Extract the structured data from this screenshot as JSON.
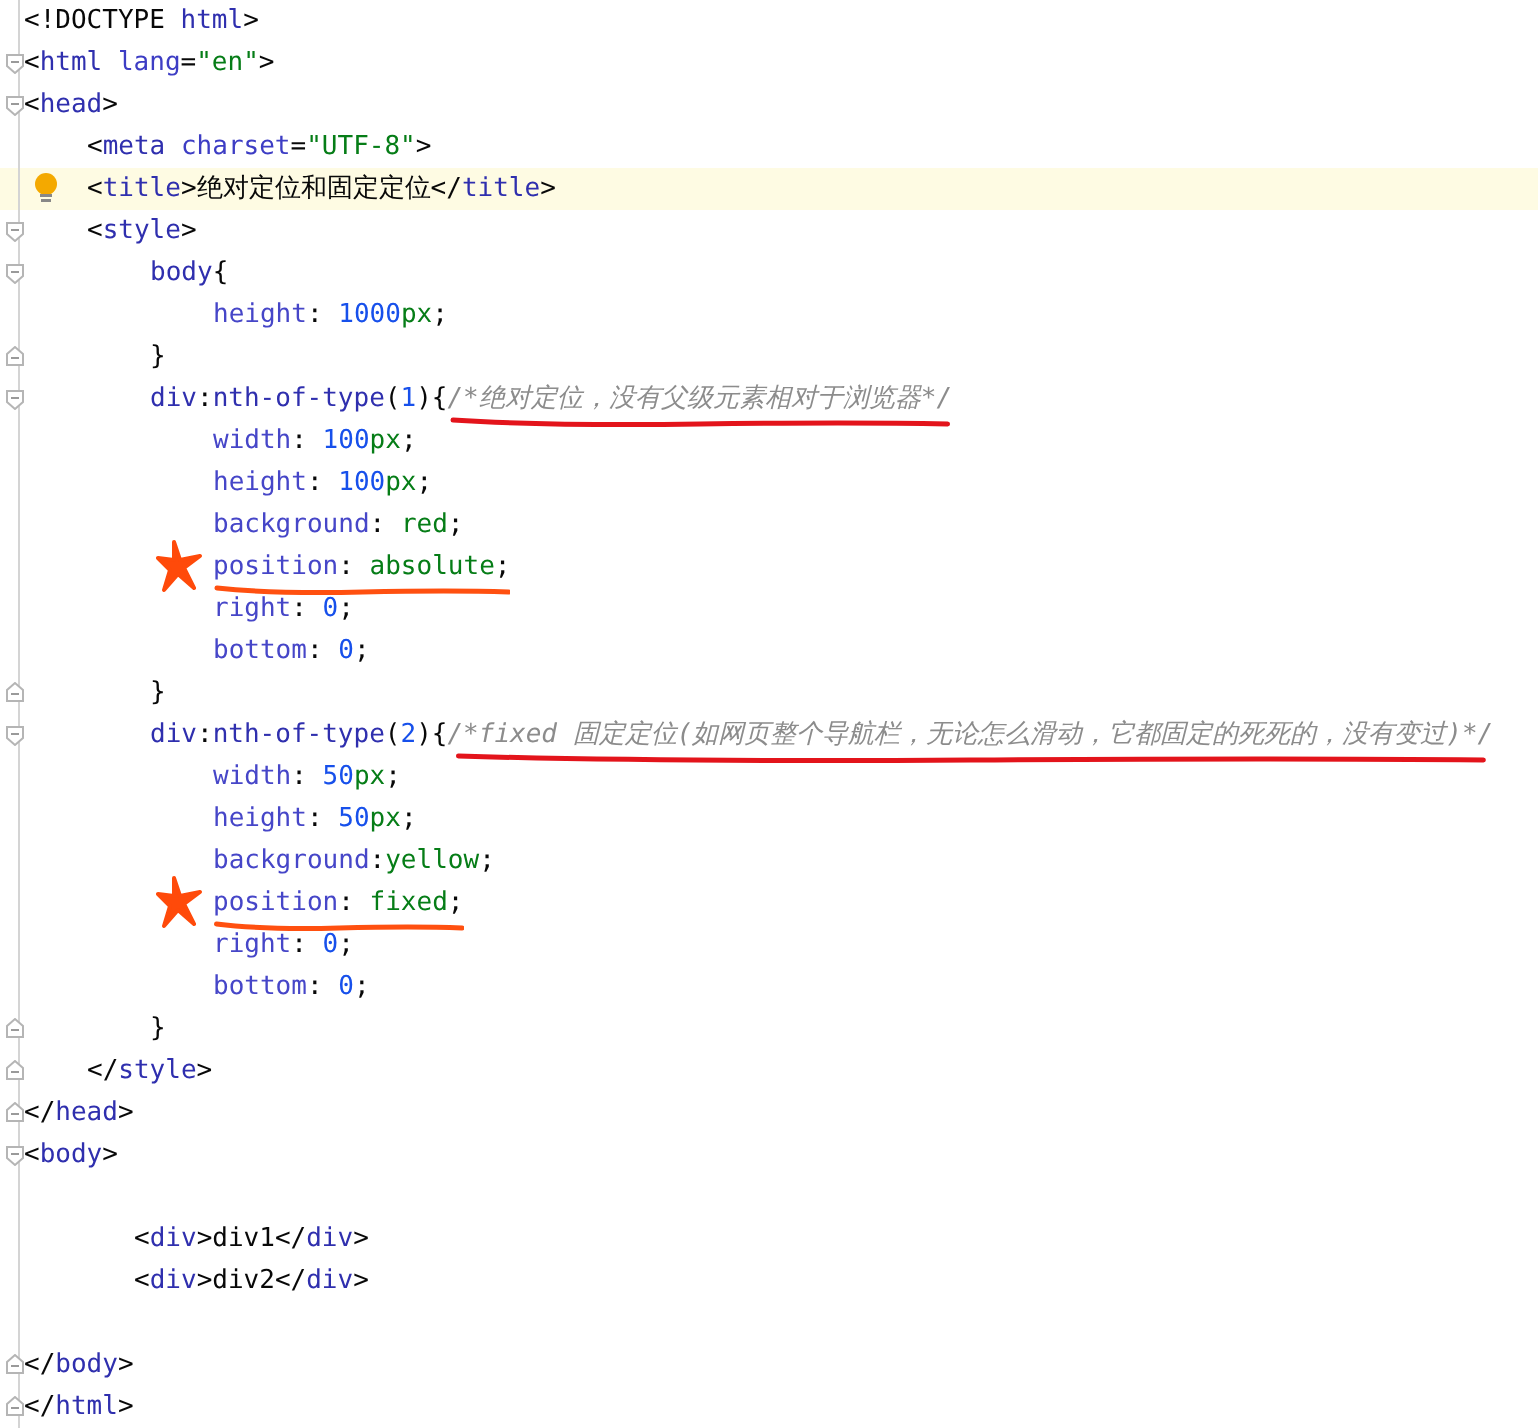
{
  "lines": [
    {
      "kind": "top",
      "current": false,
      "hint": false,
      "fold_start": false,
      "fold_end": false,
      "star": false,
      "tokens": [
        {
          "kind": "punct",
          "text": "<!DOCTYPE "
        },
        {
          "kind": "tag",
          "text": "html"
        },
        {
          "kind": "punct",
          "text": ">"
        }
      ]
    },
    {
      "kind": "top",
      "current": false,
      "hint": false,
      "fold_start": true,
      "fold_end": false,
      "star": false,
      "tokens": [
        {
          "kind": "punct",
          "text": "<"
        },
        {
          "kind": "tag",
          "text": "html"
        },
        {
          "kind": "attr",
          "text": " lang"
        },
        {
          "kind": "punct",
          "text": "="
        },
        {
          "kind": "string",
          "text": "\"en\""
        },
        {
          "kind": "punct",
          "text": ">"
        }
      ]
    },
    {
      "kind": "top",
      "current": false,
      "hint": false,
      "fold_start": true,
      "fold_end": false,
      "star": false,
      "tokens": [
        {
          "kind": "punct",
          "text": "<"
        },
        {
          "kind": "tag",
          "text": "head"
        },
        {
          "kind": "punct",
          "text": ">"
        }
      ]
    },
    {
      "kind": "element",
      "current": false,
      "hint": false,
      "fold_start": false,
      "fold_end": false,
      "star": false,
      "tokens": [
        {
          "kind": "punct",
          "text": "<"
        },
        {
          "kind": "tag",
          "text": "meta"
        },
        {
          "kind": "attr",
          "text": " charset"
        },
        {
          "kind": "punct",
          "text": "="
        },
        {
          "kind": "string",
          "text": "\"UTF-8\""
        },
        {
          "kind": "punct",
          "text": ">"
        }
      ]
    },
    {
      "kind": "element",
      "current": true,
      "hint": true,
      "fold_start": false,
      "fold_end": false,
      "star": false,
      "tokens": [
        {
          "kind": "punct",
          "text": "<"
        },
        {
          "kind": "tag",
          "text": "title"
        },
        {
          "kind": "punct",
          "text": ">"
        },
        {
          "kind": "text",
          "text": "绝对定位和固定定位"
        },
        {
          "kind": "punct",
          "text": "</"
        },
        {
          "kind": "tag",
          "text": "title"
        },
        {
          "kind": "punct",
          "text": ">"
        }
      ]
    },
    {
      "kind": "element",
      "current": false,
      "hint": false,
      "fold_start": true,
      "fold_end": false,
      "star": false,
      "tokens": [
        {
          "kind": "punct",
          "text": "<"
        },
        {
          "kind": "tag",
          "text": "style"
        },
        {
          "kind": "punct",
          "text": ">"
        }
      ]
    },
    {
      "kind": "rule",
      "current": false,
      "hint": false,
      "fold_start": true,
      "fold_end": false,
      "star": false,
      "tokens": [
        {
          "kind": "selector",
          "text": "body"
        },
        {
          "kind": "punct",
          "text": "{"
        }
      ]
    },
    {
      "kind": "declaration",
      "current": false,
      "hint": false,
      "fold_start": false,
      "fold_end": false,
      "star": false,
      "tokens": [
        {
          "kind": "prop",
          "text": "height"
        },
        {
          "kind": "punct",
          "text": ": "
        },
        {
          "kind": "number",
          "text": "1000"
        },
        {
          "kind": "value",
          "text": "px"
        },
        {
          "kind": "punct",
          "text": ";"
        }
      ]
    },
    {
      "kind": "rule",
      "current": false,
      "hint": false,
      "fold_start": false,
      "fold_end": true,
      "star": false,
      "tokens": [
        {
          "kind": "punct",
          "text": "}"
        }
      ]
    },
    {
      "kind": "rule",
      "current": false,
      "hint": false,
      "fold_start": true,
      "fold_end": false,
      "star": false,
      "tokens": [
        {
          "kind": "selector",
          "text": "div"
        },
        {
          "kind": "punct",
          "text": ":"
        },
        {
          "kind": "selector",
          "text": "nth-of-type"
        },
        {
          "kind": "punct",
          "text": "("
        },
        {
          "kind": "number",
          "text": "1"
        },
        {
          "kind": "punct",
          "text": "){"
        },
        {
          "kind": "comment",
          "text": "/*绝对定位，没有父级元素相对于浏览器*/",
          "underline": {
            "color": "#e3141b"
          }
        }
      ]
    },
    {
      "kind": "declaration",
      "current": false,
      "hint": false,
      "fold_start": false,
      "fold_end": false,
      "star": false,
      "tokens": [
        {
          "kind": "prop",
          "text": "width"
        },
        {
          "kind": "punct",
          "text": ": "
        },
        {
          "kind": "number",
          "text": "100"
        },
        {
          "kind": "value",
          "text": "px"
        },
        {
          "kind": "punct",
          "text": ";"
        }
      ]
    },
    {
      "kind": "declaration",
      "current": false,
      "hint": false,
      "fold_start": false,
      "fold_end": false,
      "star": false,
      "tokens": [
        {
          "kind": "prop",
          "text": "height"
        },
        {
          "kind": "punct",
          "text": ": "
        },
        {
          "kind": "number",
          "text": "100"
        },
        {
          "kind": "value",
          "text": "px"
        },
        {
          "kind": "punct",
          "text": ";"
        }
      ]
    },
    {
      "kind": "declaration",
      "current": false,
      "hint": false,
      "fold_start": false,
      "fold_end": false,
      "star": false,
      "tokens": [
        {
          "kind": "prop",
          "text": "background"
        },
        {
          "kind": "punct",
          "text": ": "
        },
        {
          "kind": "value",
          "text": "red"
        },
        {
          "kind": "punct",
          "text": ";"
        }
      ]
    },
    {
      "kind": "declaration",
      "current": false,
      "hint": false,
      "fold_start": false,
      "fold_end": false,
      "star": true,
      "tokens": [
        {
          "kind": "prop",
          "text": "position",
          "underline": {
            "color": "#ff5010"
          }
        },
        {
          "kind": "punct",
          "text": ": ",
          "underline": {
            "color": "#ff5010"
          }
        },
        {
          "kind": "value",
          "text": "absolute",
          "underline": {
            "color": "#ff5010"
          }
        },
        {
          "kind": "punct",
          "text": ";",
          "underline": {
            "color": "#ff5010"
          }
        }
      ]
    },
    {
      "kind": "declaration",
      "current": false,
      "hint": false,
      "fold_start": false,
      "fold_end": false,
      "star": false,
      "tokens": [
        {
          "kind": "prop",
          "text": "right"
        },
        {
          "kind": "punct",
          "text": ": "
        },
        {
          "kind": "number",
          "text": "0"
        },
        {
          "kind": "punct",
          "text": ";"
        }
      ]
    },
    {
      "kind": "declaration",
      "current": false,
      "hint": false,
      "fold_start": false,
      "fold_end": false,
      "star": false,
      "tokens": [
        {
          "kind": "prop",
          "text": "bottom"
        },
        {
          "kind": "punct",
          "text": ": "
        },
        {
          "kind": "number",
          "text": "0"
        },
        {
          "kind": "punct",
          "text": ";"
        }
      ]
    },
    {
      "kind": "rule",
      "current": false,
      "hint": false,
      "fold_start": false,
      "fold_end": true,
      "star": false,
      "tokens": [
        {
          "kind": "punct",
          "text": "}"
        }
      ]
    },
    {
      "kind": "rule",
      "current": false,
      "hint": false,
      "fold_start": true,
      "fold_end": false,
      "star": false,
      "tokens": [
        {
          "kind": "selector",
          "text": "div"
        },
        {
          "kind": "punct",
          "text": ":"
        },
        {
          "kind": "selector",
          "text": "nth-of-type"
        },
        {
          "kind": "punct",
          "text": "("
        },
        {
          "kind": "number",
          "text": "2"
        },
        {
          "kind": "punct",
          "text": "){"
        },
        {
          "kind": "comment",
          "text": "/*fixed 固定定位(如网页整个导航栏，无论怎么滑动，它都固定的死死的，没有变过)*/",
          "underline": {
            "color": "#e3141b"
          }
        }
      ]
    },
    {
      "kind": "declaration",
      "current": false,
      "hint": false,
      "fold_start": false,
      "fold_end": false,
      "star": false,
      "tokens": [
        {
          "kind": "prop",
          "text": "width"
        },
        {
          "kind": "punct",
          "text": ": "
        },
        {
          "kind": "number",
          "text": "50"
        },
        {
          "kind": "value",
          "text": "px"
        },
        {
          "kind": "punct",
          "text": ";"
        }
      ]
    },
    {
      "kind": "declaration",
      "current": false,
      "hint": false,
      "fold_start": false,
      "fold_end": false,
      "star": false,
      "tokens": [
        {
          "kind": "prop",
          "text": "height"
        },
        {
          "kind": "punct",
          "text": ": "
        },
        {
          "kind": "number",
          "text": "50"
        },
        {
          "kind": "value",
          "text": "px"
        },
        {
          "kind": "punct",
          "text": ";"
        }
      ]
    },
    {
      "kind": "declaration",
      "current": false,
      "hint": false,
      "fold_start": false,
      "fold_end": false,
      "star": false,
      "tokens": [
        {
          "kind": "prop",
          "text": "background"
        },
        {
          "kind": "punct",
          "text": ":"
        },
        {
          "kind": "value",
          "text": "yellow"
        },
        {
          "kind": "punct",
          "text": ";"
        }
      ]
    },
    {
      "kind": "declaration",
      "current": false,
      "hint": false,
      "fold_start": false,
      "fold_end": false,
      "star": true,
      "tokens": [
        {
          "kind": "prop",
          "text": "position",
          "underline": {
            "color": "#ff5010"
          }
        },
        {
          "kind": "punct",
          "text": ": ",
          "underline": {
            "color": "#ff5010"
          }
        },
        {
          "kind": "value",
          "text": "fixed",
          "underline": {
            "color": "#ff5010"
          }
        },
        {
          "kind": "punct",
          "text": ";",
          "underline": {
            "color": "#ff5010"
          }
        }
      ]
    },
    {
      "kind": "declaration",
      "current": false,
      "hint": false,
      "fold_start": false,
      "fold_end": false,
      "star": false,
      "tokens": [
        {
          "kind": "prop",
          "text": "right"
        },
        {
          "kind": "punct",
          "text": ": "
        },
        {
          "kind": "number",
          "text": "0"
        },
        {
          "kind": "punct",
          "text": ";"
        }
      ]
    },
    {
      "kind": "declaration",
      "current": false,
      "hint": false,
      "fold_start": false,
      "fold_end": false,
      "star": false,
      "tokens": [
        {
          "kind": "prop",
          "text": "bottom"
        },
        {
          "kind": "punct",
          "text": ": "
        },
        {
          "kind": "number",
          "text": "0"
        },
        {
          "kind": "punct",
          "text": ";"
        }
      ]
    },
    {
      "kind": "rule",
      "current": false,
      "hint": false,
      "fold_start": false,
      "fold_end": true,
      "star": false,
      "tokens": [
        {
          "kind": "punct",
          "text": "}"
        }
      ]
    },
    {
      "kind": "element",
      "current": false,
      "hint": false,
      "fold_start": false,
      "fold_end": true,
      "star": false,
      "tokens": [
        {
          "kind": "punct",
          "text": "</"
        },
        {
          "kind": "tag",
          "text": "style"
        },
        {
          "kind": "punct",
          "text": ">"
        }
      ]
    },
    {
      "kind": "top",
      "current": false,
      "hint": false,
      "fold_start": false,
      "fold_end": true,
      "star": false,
      "tokens": [
        {
          "kind": "punct",
          "text": "</"
        },
        {
          "kind": "tag",
          "text": "head"
        },
        {
          "kind": "punct",
          "text": ">"
        }
      ]
    },
    {
      "kind": "top",
      "current": false,
      "hint": false,
      "fold_start": true,
      "fold_end": false,
      "star": false,
      "tokens": [
        {
          "kind": "punct",
          "text": "<"
        },
        {
          "kind": "tag",
          "text": "body"
        },
        {
          "kind": "punct",
          "text": ">"
        }
      ]
    },
    {
      "kind": "blank",
      "current": false,
      "hint": false,
      "fold_start": false,
      "fold_end": false,
      "star": false
    },
    {
      "kind": "body",
      "current": false,
      "hint": false,
      "fold_start": false,
      "fold_end": false,
      "star": false,
      "tokens": [
        {
          "kind": "punct",
          "text": "<"
        },
        {
          "kind": "tag",
          "text": "div"
        },
        {
          "kind": "punct",
          "text": ">"
        },
        {
          "kind": "text",
          "text": "div1"
        },
        {
          "kind": "punct",
          "text": "</"
        },
        {
          "kind": "tag",
          "text": "div"
        },
        {
          "kind": "punct",
          "text": ">"
        }
      ]
    },
    {
      "kind": "body",
      "current": false,
      "hint": false,
      "fold_start": false,
      "fold_end": false,
      "star": false,
      "tokens": [
        {
          "kind": "punct",
          "text": "<"
        },
        {
          "kind": "tag",
          "text": "div"
        },
        {
          "kind": "punct",
          "text": ">"
        },
        {
          "kind": "text",
          "text": "div2"
        },
        {
          "kind": "punct",
          "text": "</"
        },
        {
          "kind": "tag",
          "text": "div"
        },
        {
          "kind": "punct",
          "text": ">"
        }
      ]
    },
    {
      "kind": "blank",
      "current": false,
      "hint": false,
      "fold_start": false,
      "fold_end": false,
      "star": false
    },
    {
      "kind": "top",
      "current": false,
      "hint": false,
      "fold_start": false,
      "fold_end": true,
      "star": false,
      "tokens": [
        {
          "kind": "punct",
          "text": "</"
        },
        {
          "kind": "tag",
          "text": "body"
        },
        {
          "kind": "punct",
          "text": ">"
        }
      ]
    },
    {
      "kind": "top",
      "current": false,
      "hint": false,
      "fold_start": false,
      "fold_end": true,
      "star": false,
      "tokens": [
        {
          "kind": "punct",
          "text": "</"
        },
        {
          "kind": "tag",
          "text": "html"
        },
        {
          "kind": "punct",
          "text": ">"
        }
      ]
    }
  ]
}
